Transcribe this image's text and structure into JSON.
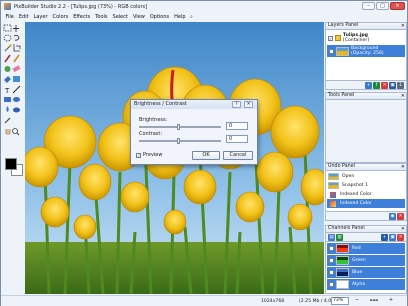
{
  "window": {
    "title": "PixBuilder Studio 2.2 - [Tulips.jpg (73%) - RGB colors]",
    "minimize": "–",
    "maximize": "□",
    "close": "✕"
  },
  "menu": [
    "File",
    "Edit",
    "Layer",
    "Colors",
    "Effects",
    "Tools",
    "Select",
    "View",
    "Options",
    "Help"
  ],
  "menu_search_icon": "⌕",
  "dialog": {
    "title": "Brightness / Contrast",
    "brightness_label": "Brightness:",
    "brightness_value": "0",
    "contrast_label": "Contrast:",
    "contrast_value": "0",
    "preview_label": "Preview",
    "preview_checked": "✓",
    "ok_label": "OK",
    "cancel_label": "Cancel",
    "close": "✕",
    "help": "?"
  },
  "layers_panel": {
    "title": "Layers Panel",
    "close": "✕",
    "items": [
      {
        "name": "Tulips.jpg",
        "sub": "[Container]",
        "check": "✓"
      },
      {
        "name": "Background",
        "sub": "(Opacity: 256)",
        "check": "✓"
      }
    ]
  },
  "tools_panel": {
    "title": "Tools Panel",
    "close": "✕"
  },
  "undo_panel": {
    "title": "Undo Panel",
    "close": "✕",
    "items": [
      "Open",
      "Snapshot 1",
      "Indexed Color",
      "Indexed Color"
    ]
  },
  "channels_panel": {
    "title": "Channels Panel",
    "close": "✕",
    "items": [
      {
        "name": "Red",
        "check": "✓"
      },
      {
        "name": "Green",
        "check": "✓"
      },
      {
        "name": "Blue",
        "check": "✓"
      },
      {
        "name": "Alpha",
        "check": "✓"
      }
    ]
  },
  "status": {
    "dimensions": "1024x768",
    "memory": "(2.25 Mb / 4.05 Mb)",
    "zoom": "73%",
    "zoom_in": "+",
    "zoom_out": "−"
  },
  "colors": {
    "foreground": "#000000",
    "background": "#ffffff",
    "selection": "#3d7fd9",
    "panel_accent": "#1a8a3a"
  }
}
